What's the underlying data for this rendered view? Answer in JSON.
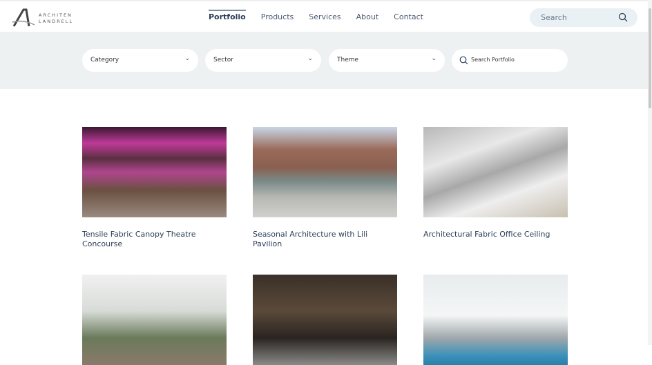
{
  "brand": {
    "line1": "ARCHITEN",
    "line2": "LANDRELL"
  },
  "nav": [
    {
      "label": "Portfolio",
      "active": true
    },
    {
      "label": "Products"
    },
    {
      "label": "Services"
    },
    {
      "label": "About"
    },
    {
      "label": "Contact"
    }
  ],
  "search": {
    "placeholder": "Search"
  },
  "filters": {
    "category": "Category",
    "sector": "Sector",
    "theme": "Theme",
    "search_placeholder": "Search Portfolio"
  },
  "projects": [
    {
      "title": "Tensile Fabric Canopy Theatre Concourse"
    },
    {
      "title": "Seasonal Architecture with Lili Pavilion"
    },
    {
      "title": "Architectural Fabric Office Ceiling"
    },
    {
      "title": ""
    },
    {
      "title": ""
    },
    {
      "title": ""
    }
  ]
}
